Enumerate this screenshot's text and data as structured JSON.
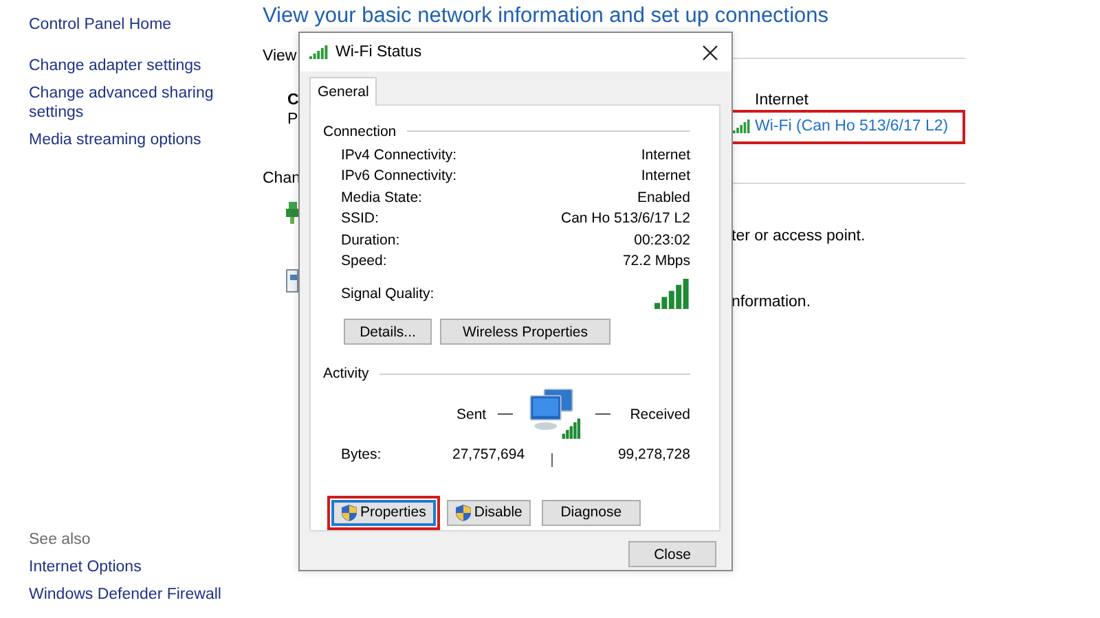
{
  "sidebar": {
    "home": "Control Panel Home",
    "links": [
      "Change adapter settings",
      "Change advanced sharing settings",
      "Media streaming options"
    ],
    "see_also": {
      "heading": "See also",
      "links": [
        "Internet Options",
        "Windows Defender Firewall"
      ]
    }
  },
  "main": {
    "heading": "View your basic network information and set up connections",
    "view_fragment": "View",
    "name_fragment": "C",
    "type_fragment": "P",
    "change_fragment": "Chan",
    "access_type_label": "Internet",
    "connection_link": {
      "label": "Wi-Fi (Can Ho 513/6/17 L2)",
      "highlighted": true
    },
    "setup_fragment": "ter or access point.",
    "troubleshoot_fragment": "nformation."
  },
  "dialog": {
    "title": "Wi-Fi Status",
    "tabs": [
      {
        "label": "General",
        "selected": true
      }
    ],
    "connection": {
      "heading": "Connection",
      "rows": [
        {
          "label": "IPv4 Connectivity:",
          "value": "Internet"
        },
        {
          "label": "IPv6 Connectivity:",
          "value": "Internet"
        },
        {
          "label": "Media State:",
          "value": "Enabled"
        },
        {
          "label": "SSID:",
          "value": "Can Ho 513/6/17 L2"
        },
        {
          "label": "Duration:",
          "value": "00:23:02"
        },
        {
          "label": "Speed:",
          "value": "72.2 Mbps"
        }
      ],
      "signal_label": "Signal Quality:",
      "buttons": [
        "Details...",
        "Wireless Properties"
      ]
    },
    "activity": {
      "heading": "Activity",
      "sent_label": "Sent",
      "received_label": "Received",
      "bytes_label": "Bytes:",
      "sent_value": "27,757,694",
      "received_value": "99,278,728"
    },
    "action_buttons": [
      {
        "label": "Properties",
        "shield": true,
        "focused": true,
        "highlighted": true
      },
      {
        "label": "Disable",
        "shield": true,
        "focused": false,
        "highlighted": false
      },
      {
        "label": "Diagnose",
        "shield": false,
        "focused": false,
        "highlighted": false
      }
    ],
    "close_button": "Close"
  }
}
